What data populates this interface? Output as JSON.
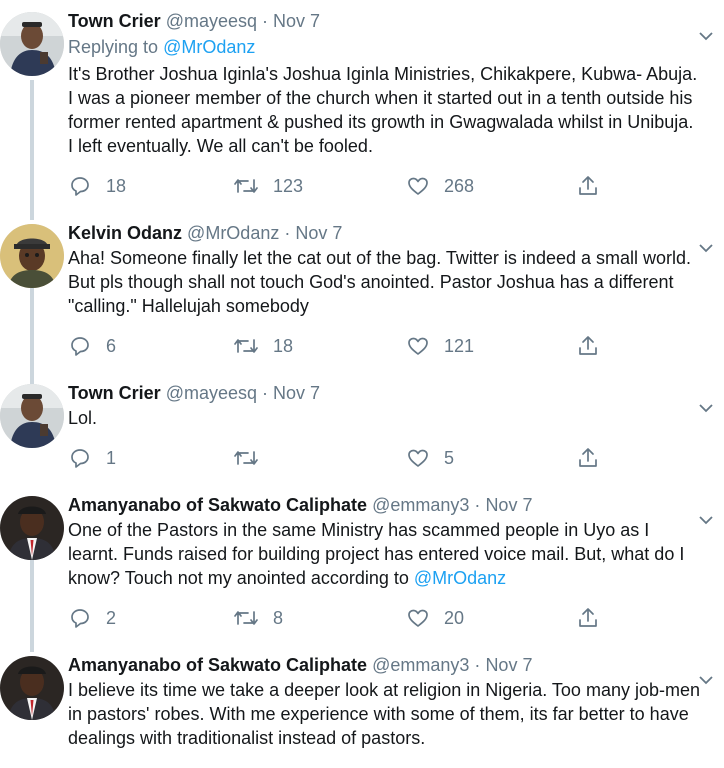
{
  "tweets": [
    {
      "name": "Town Crier",
      "handle": "@mayeesq",
      "dot": "·",
      "date": "Nov 7",
      "reply_prefix": "Replying to",
      "reply_handle": "@MrOdanz",
      "body": "It's Brother Joshua Iginla's Joshua Iginla Ministries, Chikakpere, Kubwa- Abuja. I was a pioneer member of the church when it started out in a tenth outside his former rented apartment & pushed its growth in Gwagwalada whilst in Unibuja. I left eventually. We all can't be fooled.",
      "replies": "18",
      "retweets": "123",
      "likes": "268"
    },
    {
      "name": "Kelvin Odanz",
      "handle": "@MrOdanz",
      "dot": "·",
      "date": "Nov 7",
      "body": "Aha! Someone finally let the cat out of the bag. Twitter is indeed a small world. But pls though shall not touch God's anointed. Pastor Joshua has a different \"calling.\" Hallelujah somebody",
      "replies": "6",
      "retweets": "18",
      "likes": "121"
    },
    {
      "name": "Town Crier",
      "handle": "@mayeesq",
      "dot": "·",
      "date": "Nov 7",
      "body": "Lol.",
      "replies": "1",
      "retweets": "",
      "likes": "5"
    },
    {
      "name": "Amanyanabo of Sakwato Caliphate",
      "handle": "@emmany3",
      "dot": "·",
      "date": "Nov 7",
      "body": "One of the Pastors in the same Ministry has scammed people in Uyo as I learnt. Funds raised for building project has entered voice mail. But, what do I know? Touch not my anointed according to ",
      "body_mention": "@MrOdanz",
      "replies": "2",
      "retweets": "8",
      "likes": "20"
    },
    {
      "name": "Amanyanabo of Sakwato Caliphate",
      "handle": "@emmany3",
      "dot": "·",
      "date": "Nov 7",
      "body": "I believe its time we take a deeper look at religion in Nigeria. Too many job-men in pastors' robes. With me experience with some of them, its far better to have dealings with traditionalist instead of pastors."
    }
  ],
  "icons": {
    "reply": "reply-icon",
    "retweet": "retweet-icon",
    "like": "like-icon",
    "share": "share-icon",
    "caret": "chevron-down-icon"
  },
  "colors": {
    "text": "#14171a",
    "secondary": "#657786",
    "link": "#1da1f2",
    "thread_line": "#ccd6dd"
  }
}
